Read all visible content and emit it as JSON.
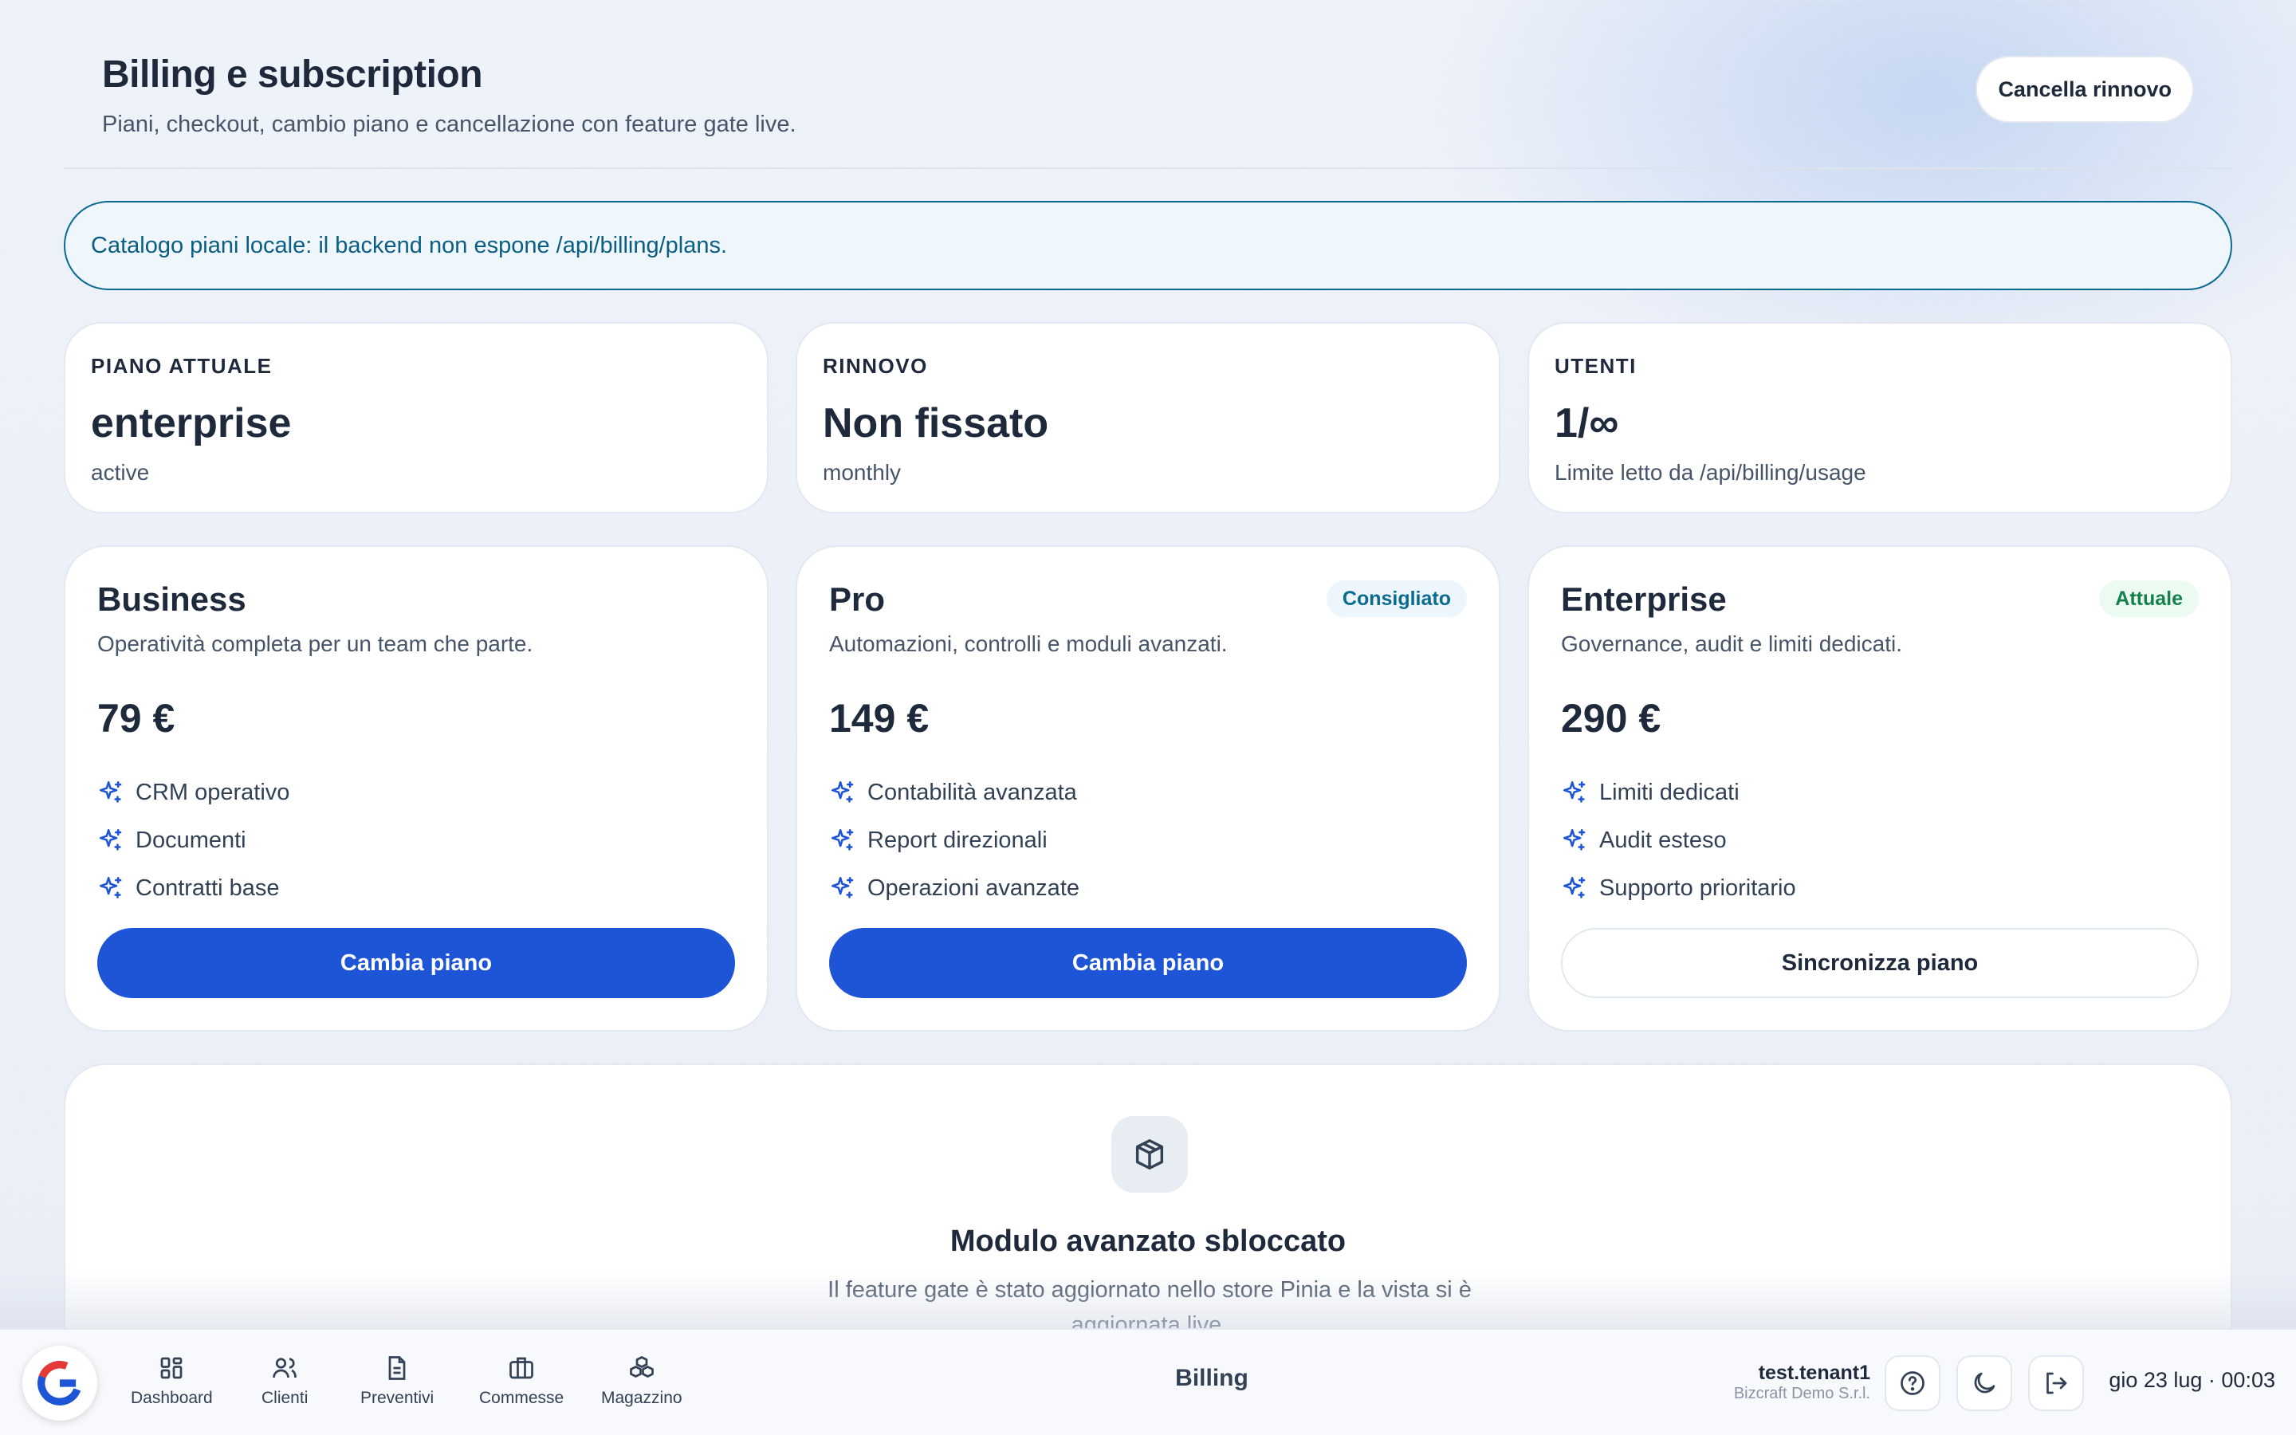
{
  "header": {
    "title": "Billing e subscription",
    "subtitle": "Piani, checkout, cambio piano e cancellazione con feature gate live.",
    "cancel_label": "Cancella rinnovo"
  },
  "banner": {
    "text": "Catalogo piani locale: il backend non espone /api/billing/plans."
  },
  "stats": [
    {
      "label": "PIANO ATTUALE",
      "value": "enterprise",
      "sub": "active"
    },
    {
      "label": "RINNOVO",
      "value": "Non fissato",
      "sub": "monthly"
    },
    {
      "label": "UTENTI",
      "value": "1/∞",
      "sub": "Limite letto da /api/billing/usage"
    }
  ],
  "plans": [
    {
      "name": "Business",
      "desc": "Operatività completa per un team che parte.",
      "price": "79 €",
      "features": [
        "CRM operativo",
        "Documenti",
        "Contratti base"
      ],
      "button": "Cambia piano",
      "badge": ""
    },
    {
      "name": "Pro",
      "desc": "Automazioni, controlli e moduli avanzati.",
      "price": "149 €",
      "features": [
        "Contabilità avanzata",
        "Report direzionali",
        "Operazioni avanzate"
      ],
      "button": "Cambia piano",
      "badge": "Consigliato"
    },
    {
      "name": "Enterprise",
      "desc": "Governance, audit e limiti dedicati.",
      "price": "290 €",
      "features": [
        "Limiti dedicati",
        "Audit esteso",
        "Supporto prioritario"
      ],
      "button": "Sincronizza piano",
      "badge": "Attuale"
    }
  ],
  "module": {
    "title": "Modulo avanzato sbloccato",
    "text": "Il feature gate è stato aggiornato nello store Pinia e la vista si è aggiornata live."
  },
  "bottombar": {
    "nav": [
      {
        "label": "Dashboard",
        "icon": "dashboard-icon"
      },
      {
        "label": "Clienti",
        "icon": "users-icon"
      },
      {
        "label": "Preventivi",
        "icon": "document-icon"
      },
      {
        "label": "Commesse",
        "icon": "briefcase-icon"
      },
      {
        "label": "Magazzino",
        "icon": "boxes-icon"
      }
    ],
    "title": "Billing",
    "user_name": "test.tenant1",
    "user_org": "Bizcraft Demo S.r.l.",
    "clock": "gio 23 lug · 00:03"
  },
  "colors": {
    "primary": "#1d55d6",
    "info": "#0b6a8f",
    "success": "#14804a",
    "spark_icon": "#1d55d6"
  }
}
